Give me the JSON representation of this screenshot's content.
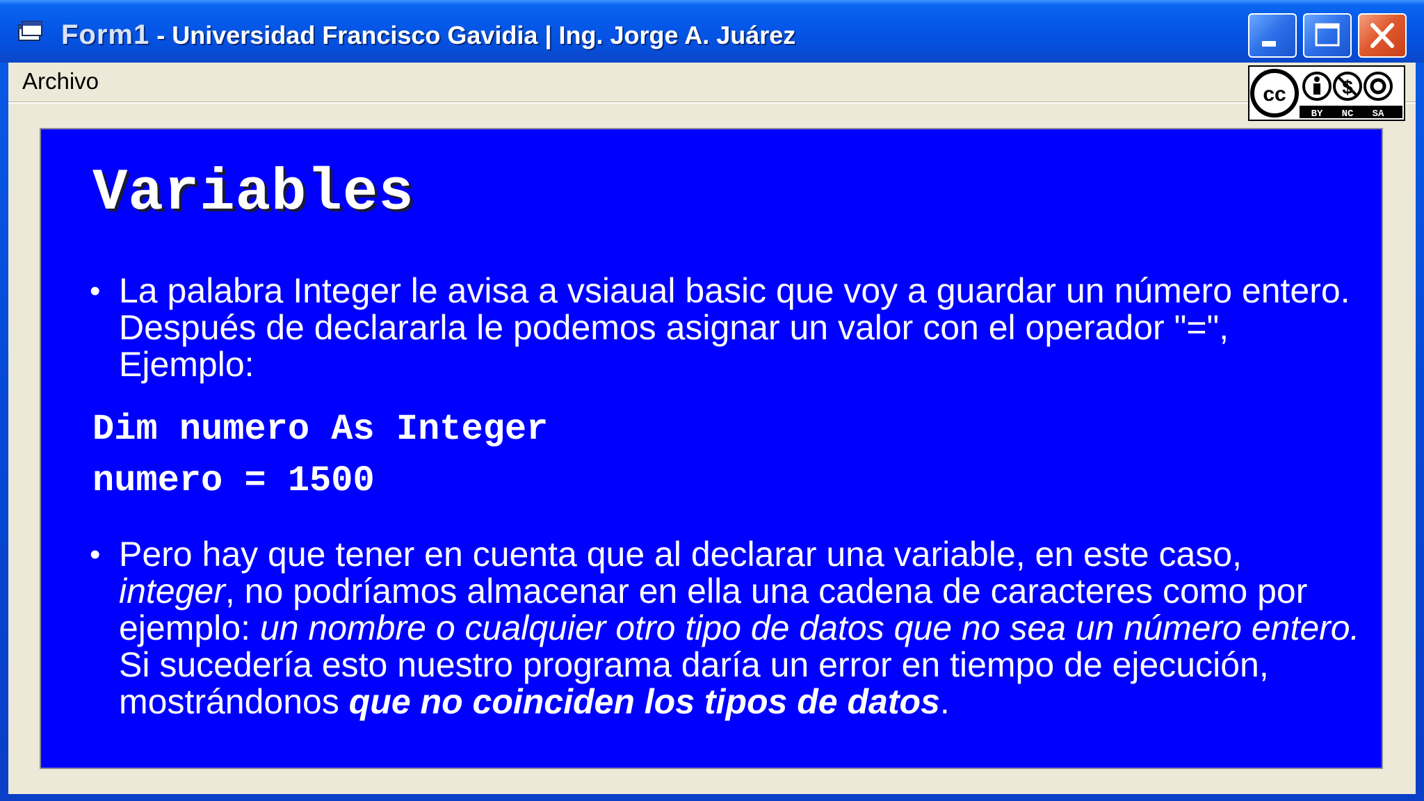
{
  "window": {
    "app_name": "Form1",
    "title_suffix": " - Universidad Francisco Gavidia | Ing. Jorge A. Juárez"
  },
  "menu": {
    "items": [
      {
        "label": "Archivo"
      }
    ]
  },
  "license_badge": {
    "labels": [
      "BY",
      "NC",
      "SA"
    ]
  },
  "slide": {
    "title": "Variables",
    "bullet1": {
      "bullet": "•",
      "text": "La palabra Integer le avisa a vsiaual basic que voy a guardar un número entero. Después de declararla le podemos asignar un valor con el operador \"=\", Ejemplo:"
    },
    "code": [
      "Dim numero As Integer",
      "numero = 1500"
    ],
    "bullet2": {
      "bullet": "•",
      "part1": "Pero hay que tener en cuenta que al declarar una variable, en este caso, ",
      "part2_italic": "integer",
      "part3": ", no podríamos almacenar en ella una cadena de caracteres como por ejemplo: ",
      "part4_italic": "un nombre o cualquier otro tipo de datos que no sea un número entero.",
      "part5": " Si sucedería esto nuestro programa daría un error en tiempo de ejecución, mostrándonos ",
      "part6_bold_italic": "que no coinciden los tipos de datos",
      "part7": "."
    }
  },
  "colors": {
    "titlebar": "#0558e8",
    "client_bg": "#ece9d8",
    "slide_bg": "#0000ff",
    "slide_text": "#ffffff",
    "close_button": "#e05a30"
  }
}
